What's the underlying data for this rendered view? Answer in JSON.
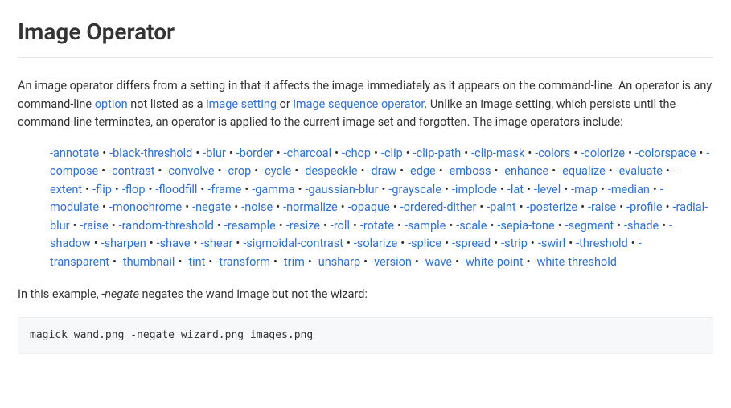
{
  "heading": "Image Operator",
  "intro": {
    "t1": "An image operator differs from a setting in that it affects the image immediately as it appears on the command-line. An operator is any command-line ",
    "link_option": "option",
    "t2": " not listed as a ",
    "link_image_setting": "image setting",
    "t3": " or ",
    "link_image_sequence_operator": "image sequence operator",
    "t4": ". Unlike an image setting, which persists until the command-line terminates, an operator is applied to the current image set and forgotten. The image operators include:"
  },
  "operators": [
    "-annotate",
    "-black-threshold",
    "-blur",
    "-border",
    "-charcoal",
    "-chop",
    "-clip",
    "-clip-path",
    "-clip-mask",
    "-colors",
    "-colorize",
    "-colorspace",
    "-compose",
    "-contrast",
    "-convolve",
    "-crop",
    "-cycle",
    "-despeckle",
    "-draw",
    "-edge",
    "-emboss",
    "-enhance",
    "-equalize",
    "-evaluate",
    "-extent",
    "-flip",
    "-flop",
    "-floodfill",
    "-frame",
    "-gamma",
    "-gaussian-blur",
    "-grayscale",
    "-implode",
    "-lat",
    "-level",
    "-map",
    "-median",
    "-modulate",
    "-monochrome",
    "-negate",
    "-noise",
    "-normalize",
    "-opaque",
    "-ordered-dither",
    "-paint",
    "-posterize",
    "-raise",
    "-profile",
    "-radial-blur",
    "-raise",
    "-random-threshold",
    "-resample",
    "-resize",
    "-roll",
    "-rotate",
    "-sample",
    "-scale",
    "-sepia-tone",
    "-segment",
    "-shade",
    "-shadow",
    "-sharpen",
    "-shave",
    "-shear",
    "-sigmoidal-contrast",
    "-solarize",
    "-splice",
    "-spread",
    "-strip",
    "-swirl",
    "-threshold",
    "-transparent",
    "-thumbnail",
    "-tint",
    "-transform",
    "-trim",
    "-unsharp",
    "-version",
    "-wave",
    "-white-point",
    "-white-threshold"
  ],
  "example_sentence": {
    "t1": "In this example, ",
    "neg": "-negate",
    "t2": " negates the wand image but not the wizard:"
  },
  "code": "magick wand.png -negate wizard.png images.png"
}
